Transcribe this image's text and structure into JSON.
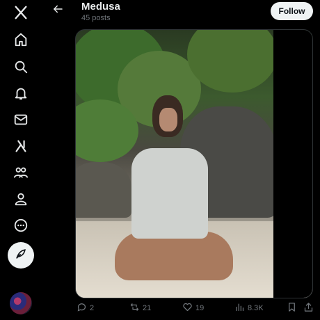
{
  "sidebar": {
    "items": [
      {
        "icon": "x-logo-icon"
      },
      {
        "icon": "home-icon"
      },
      {
        "icon": "search-icon"
      },
      {
        "icon": "notifications-bell-icon"
      },
      {
        "icon": "messages-envelope-icon"
      },
      {
        "icon": "grok-icon"
      },
      {
        "icon": "communities-icon"
      },
      {
        "icon": "profile-icon"
      },
      {
        "icon": "more-circle-icon"
      }
    ],
    "compose_icon": "compose-feather-icon"
  },
  "header": {
    "name": "Medusa",
    "posts": "45 posts",
    "follow_label": "Follow"
  },
  "actions": {
    "replies": "2",
    "reposts": "21",
    "likes": "19",
    "views": "8.3K"
  },
  "colors": {
    "background": "#000000",
    "text_primary": "#e7e9ea",
    "text_secondary": "#71767b",
    "button_light": "#eff3f4"
  }
}
